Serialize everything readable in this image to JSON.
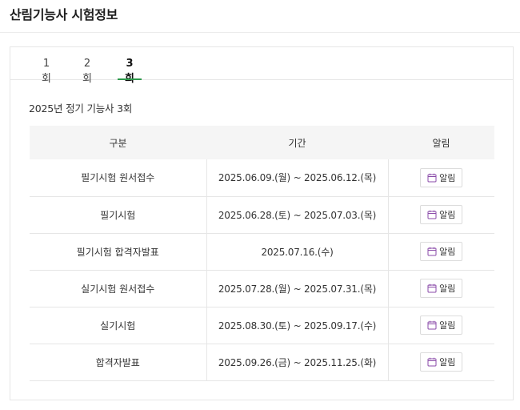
{
  "page": {
    "title": "산림기능사 시험정보"
  },
  "tabs": [
    {
      "label": "1회",
      "active": false
    },
    {
      "label": "2회",
      "active": false
    },
    {
      "label": "3회",
      "active": true
    }
  ],
  "section": {
    "title": "2025년 정기 기능사 3회"
  },
  "table": {
    "headers": [
      "구분",
      "기간",
      "알림"
    ],
    "alarm_label": "알림",
    "rows": [
      {
        "category": "필기시험 원서접수",
        "period": "2025.06.09.(월) ~ 2025.06.12.(목)"
      },
      {
        "category": "필기시험",
        "period": "2025.06.28.(토) ~ 2025.07.03.(목)"
      },
      {
        "category": "필기시험 합격자발표",
        "period": "2025.07.16.(수)"
      },
      {
        "category": "실기시험 원서접수",
        "period": "2025.07.28.(월) ~ 2025.07.31.(목)"
      },
      {
        "category": "실기시험",
        "period": "2025.08.30.(토) ~ 2025.09.17.(수)"
      },
      {
        "category": "합격자발표",
        "period": "2025.09.26.(금) ~ 2025.11.25.(화)"
      }
    ]
  },
  "colors": {
    "accent": "#2e9a4c",
    "icon": "#8a4aa8"
  },
  "icons": {
    "alarm": "calendar-icon"
  }
}
